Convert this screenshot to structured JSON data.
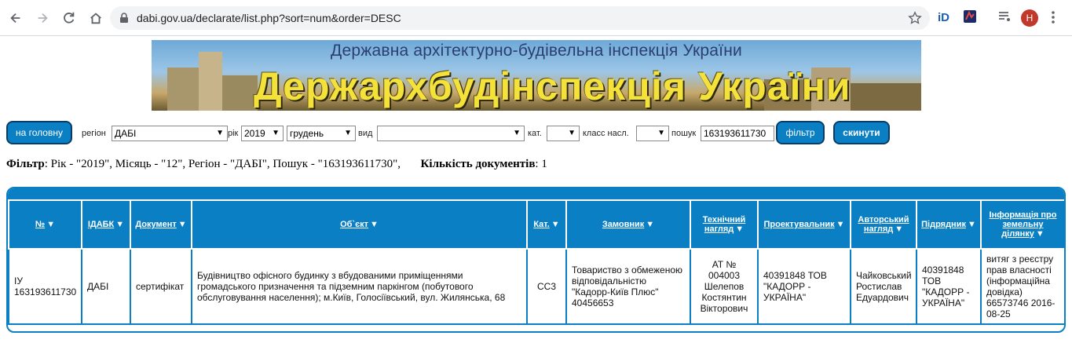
{
  "browser": {
    "url": "dabi.gov.ua/declarate/list.php?sort=num&order=DESC",
    "profile_initial": "Н"
  },
  "banner": {
    "top_text": "Державна архітектурно-будівельна інспекція України",
    "big_text": "Держархбудінспекція України"
  },
  "filters": {
    "home_button": "на головну",
    "region_label": "регіон",
    "region_value": "ДАБІ",
    "year_label": "рік",
    "year_value": "2019",
    "month_value": "грудень",
    "type_label": "вид",
    "type_value": "",
    "cat_label": "кат.",
    "cat_value": "",
    "class_label": "класс насл.",
    "class_value": "",
    "search_label": "пошук",
    "search_value": "163193611730",
    "filter_button": "фільтр",
    "reset_button": "скинути"
  },
  "summary": {
    "filter_label": "Фільтр",
    "filter_text": ": Рік - \"2019\", Місяць - \"12\", Регіон - \"ДАБІ\", Пошук - \"163193611730\",",
    "count_label": "Кількість документів",
    "count_value": ": 1"
  },
  "table": {
    "headers": [
      "№",
      "ІДАБК",
      "Документ",
      "Об`єкт",
      "Кат.",
      "Замовник",
      "Технічний нагляд",
      "Проектувальник",
      "Авторський нагляд",
      "Підрядник",
      "Інформація про земельну ділянку"
    ],
    "rows": [
      [
        "ІУ 163193611730",
        "ДАБІ",
        "сертифікат",
        "Будівництво офісного будинку з вбудованими приміщеннями громадського призначення та підземним паркінгом (побутового обслуговування населення); м.Київ, Голосіївський, вул. Жилянська, 68",
        "СС3",
        "Товариство з обмеженою відповідальністю \"Кадорр-Київ Плюс\" 40456653",
        "АТ № 004003 Шелепов Костянтин Вікторович",
        "40391848 ТОВ \"КАДОРР - УКРАЇНА\"",
        "Чайковський Ростислав Едуардович",
        "40391848 ТОВ \"КАДОРР - УКРАЇНА\"",
        "витяг з реєстру прав власності (інформаційна довідка) 66573746 2016-08-25"
      ]
    ]
  }
}
